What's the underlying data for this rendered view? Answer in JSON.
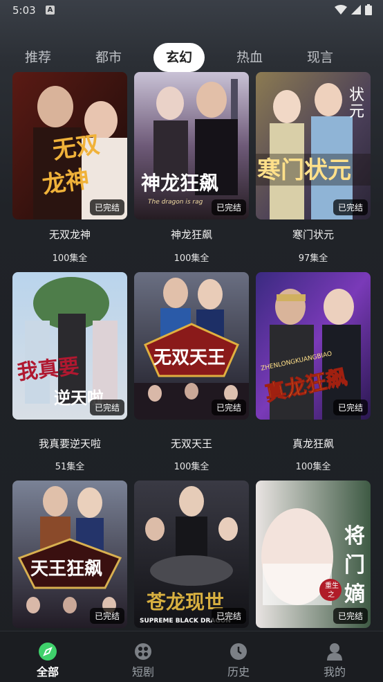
{
  "status": {
    "time": "5:03",
    "notif_icon": "A"
  },
  "tabs": [
    {
      "label": "推荐"
    },
    {
      "label": "都市"
    },
    {
      "label": "玄幻"
    },
    {
      "label": "热血"
    },
    {
      "label": "现言"
    }
  ],
  "active_tab_index": 2,
  "dramas": [
    {
      "title": "无双龙神",
      "episodes": "100集全",
      "status": "已完结",
      "poster_text": "无双龙神",
      "poster_subtext": ""
    },
    {
      "title": "神龙狂飙",
      "episodes": "100集全",
      "status": "已完结",
      "poster_text": "神龙狂飙",
      "poster_subtext": "The dragon is rag"
    },
    {
      "title": "寒门状元",
      "episodes": "97集全",
      "status": "已完结",
      "poster_text": "寒门状元",
      "poster_subtext": "状元"
    },
    {
      "title": "我真要逆天啦",
      "episodes": "51集全",
      "status": "已完结",
      "poster_text": "我真要逆天啦",
      "poster_subtext": ""
    },
    {
      "title": "无双天王",
      "episodes": "100集全",
      "status": "已完结",
      "poster_text": "无双天王",
      "poster_subtext": ""
    },
    {
      "title": "真龙狂飙",
      "episodes": "100集全",
      "status": "已完结",
      "poster_text": "真龙狂飙",
      "poster_subtext": "ZHENLONGKUANGBIAO"
    },
    {
      "title": "",
      "episodes": "",
      "status": "已完结",
      "poster_text": "天王狂飙",
      "poster_subtext": ""
    },
    {
      "title": "",
      "episodes": "",
      "status": "已完结",
      "poster_text": "苍龙现世",
      "poster_subtext": "SUPREME BLACK DRAGON"
    },
    {
      "title": "",
      "episodes": "",
      "status": "已完结",
      "poster_text": "将门嫡",
      "poster_subtext": "重生之"
    }
  ],
  "bottom_nav": [
    {
      "label": "全部",
      "icon": "compass-icon"
    },
    {
      "label": "短剧",
      "icon": "film-reel-icon"
    },
    {
      "label": "历史",
      "icon": "clock-icon"
    },
    {
      "label": "我的",
      "icon": "user-icon"
    }
  ],
  "colors": {
    "accent": "#3fd16b",
    "badge_bg": "#000000",
    "active_tab_bg": "#ffffff"
  }
}
